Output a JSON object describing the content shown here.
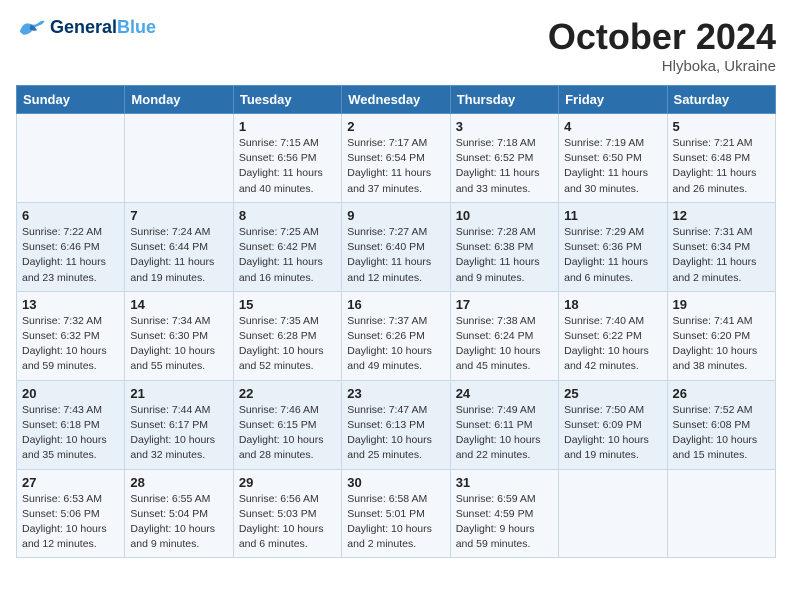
{
  "header": {
    "logo_general": "General",
    "logo_blue": "Blue",
    "month": "October 2024",
    "location": "Hlyboka, Ukraine"
  },
  "weekdays": [
    "Sunday",
    "Monday",
    "Tuesday",
    "Wednesday",
    "Thursday",
    "Friday",
    "Saturday"
  ],
  "weeks": [
    [
      {
        "day": "",
        "detail": ""
      },
      {
        "day": "",
        "detail": ""
      },
      {
        "day": "1",
        "detail": "Sunrise: 7:15 AM\nSunset: 6:56 PM\nDaylight: 11 hours and 40 minutes."
      },
      {
        "day": "2",
        "detail": "Sunrise: 7:17 AM\nSunset: 6:54 PM\nDaylight: 11 hours and 37 minutes."
      },
      {
        "day": "3",
        "detail": "Sunrise: 7:18 AM\nSunset: 6:52 PM\nDaylight: 11 hours and 33 minutes."
      },
      {
        "day": "4",
        "detail": "Sunrise: 7:19 AM\nSunset: 6:50 PM\nDaylight: 11 hours and 30 minutes."
      },
      {
        "day": "5",
        "detail": "Sunrise: 7:21 AM\nSunset: 6:48 PM\nDaylight: 11 hours and 26 minutes."
      }
    ],
    [
      {
        "day": "6",
        "detail": "Sunrise: 7:22 AM\nSunset: 6:46 PM\nDaylight: 11 hours and 23 minutes."
      },
      {
        "day": "7",
        "detail": "Sunrise: 7:24 AM\nSunset: 6:44 PM\nDaylight: 11 hours and 19 minutes."
      },
      {
        "day": "8",
        "detail": "Sunrise: 7:25 AM\nSunset: 6:42 PM\nDaylight: 11 hours and 16 minutes."
      },
      {
        "day": "9",
        "detail": "Sunrise: 7:27 AM\nSunset: 6:40 PM\nDaylight: 11 hours and 12 minutes."
      },
      {
        "day": "10",
        "detail": "Sunrise: 7:28 AM\nSunset: 6:38 PM\nDaylight: 11 hours and 9 minutes."
      },
      {
        "day": "11",
        "detail": "Sunrise: 7:29 AM\nSunset: 6:36 PM\nDaylight: 11 hours and 6 minutes."
      },
      {
        "day": "12",
        "detail": "Sunrise: 7:31 AM\nSunset: 6:34 PM\nDaylight: 11 hours and 2 minutes."
      }
    ],
    [
      {
        "day": "13",
        "detail": "Sunrise: 7:32 AM\nSunset: 6:32 PM\nDaylight: 10 hours and 59 minutes."
      },
      {
        "day": "14",
        "detail": "Sunrise: 7:34 AM\nSunset: 6:30 PM\nDaylight: 10 hours and 55 minutes."
      },
      {
        "day": "15",
        "detail": "Sunrise: 7:35 AM\nSunset: 6:28 PM\nDaylight: 10 hours and 52 minutes."
      },
      {
        "day": "16",
        "detail": "Sunrise: 7:37 AM\nSunset: 6:26 PM\nDaylight: 10 hours and 49 minutes."
      },
      {
        "day": "17",
        "detail": "Sunrise: 7:38 AM\nSunset: 6:24 PM\nDaylight: 10 hours and 45 minutes."
      },
      {
        "day": "18",
        "detail": "Sunrise: 7:40 AM\nSunset: 6:22 PM\nDaylight: 10 hours and 42 minutes."
      },
      {
        "day": "19",
        "detail": "Sunrise: 7:41 AM\nSunset: 6:20 PM\nDaylight: 10 hours and 38 minutes."
      }
    ],
    [
      {
        "day": "20",
        "detail": "Sunrise: 7:43 AM\nSunset: 6:18 PM\nDaylight: 10 hours and 35 minutes."
      },
      {
        "day": "21",
        "detail": "Sunrise: 7:44 AM\nSunset: 6:17 PM\nDaylight: 10 hours and 32 minutes."
      },
      {
        "day": "22",
        "detail": "Sunrise: 7:46 AM\nSunset: 6:15 PM\nDaylight: 10 hours and 28 minutes."
      },
      {
        "day": "23",
        "detail": "Sunrise: 7:47 AM\nSunset: 6:13 PM\nDaylight: 10 hours and 25 minutes."
      },
      {
        "day": "24",
        "detail": "Sunrise: 7:49 AM\nSunset: 6:11 PM\nDaylight: 10 hours and 22 minutes."
      },
      {
        "day": "25",
        "detail": "Sunrise: 7:50 AM\nSunset: 6:09 PM\nDaylight: 10 hours and 19 minutes."
      },
      {
        "day": "26",
        "detail": "Sunrise: 7:52 AM\nSunset: 6:08 PM\nDaylight: 10 hours and 15 minutes."
      }
    ],
    [
      {
        "day": "27",
        "detail": "Sunrise: 6:53 AM\nSunset: 5:06 PM\nDaylight: 10 hours and 12 minutes."
      },
      {
        "day": "28",
        "detail": "Sunrise: 6:55 AM\nSunset: 5:04 PM\nDaylight: 10 hours and 9 minutes."
      },
      {
        "day": "29",
        "detail": "Sunrise: 6:56 AM\nSunset: 5:03 PM\nDaylight: 10 hours and 6 minutes."
      },
      {
        "day": "30",
        "detail": "Sunrise: 6:58 AM\nSunset: 5:01 PM\nDaylight: 10 hours and 2 minutes."
      },
      {
        "day": "31",
        "detail": "Sunrise: 6:59 AM\nSunset: 4:59 PM\nDaylight: 9 hours and 59 minutes."
      },
      {
        "day": "",
        "detail": ""
      },
      {
        "day": "",
        "detail": ""
      }
    ]
  ]
}
